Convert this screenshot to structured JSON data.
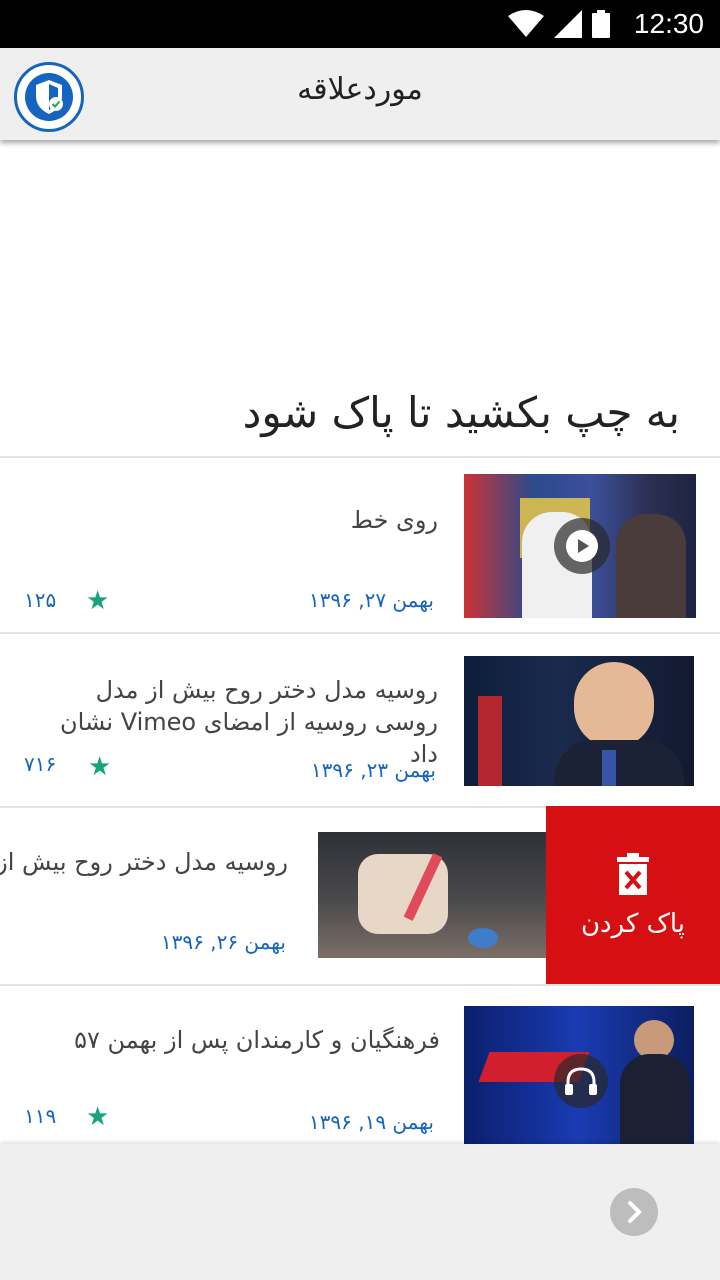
{
  "status_bar": {
    "time": "12:30",
    "icons": [
      "wifi-icon",
      "signal-icon",
      "battery-icon"
    ]
  },
  "app_bar": {
    "title": "موردعلاقه",
    "logo_icon": "shield-check-icon"
  },
  "hint": "به چپ بکشید تا پاک شود",
  "colors": {
    "accent": "#1565c0",
    "star": "#17a47d",
    "delete": "#d50f12",
    "app_bar_bg": "#efefef"
  },
  "items": [
    {
      "title": "روی خط",
      "date": "بهمن ۲۷, ۱۳۹۶",
      "count": "۱۲۵",
      "overlay_icon": "play-icon"
    },
    {
      "title": "روسیه مدل دختر روح بیش از مدل روسی روسیه از امضای Vimeo نشان داد",
      "date": "بهمن ۲۳, ۱۳۹۶",
      "count": "۷۱۶",
      "overlay_icon": ""
    },
    {
      "title": "روسیه مدل دختر روح بیش از مدل روسی روسیه از امضای Vimeo نشان داد",
      "date": "بهمن ۲۶, ۱۳۹۶",
      "count": "",
      "overlay_icon": ""
    },
    {
      "title": "فرهنگیان و کارمندان پس از بهمن ۵۷",
      "date": "بهمن ۱۹, ۱۳۹۶",
      "count": "۱۱۹",
      "overlay_icon": "headphones-icon"
    }
  ],
  "delete_action": {
    "label": "پاک کردن",
    "icon": "trash-icon"
  },
  "bottom_bar": {
    "next_icon": "chevron-right-icon"
  }
}
